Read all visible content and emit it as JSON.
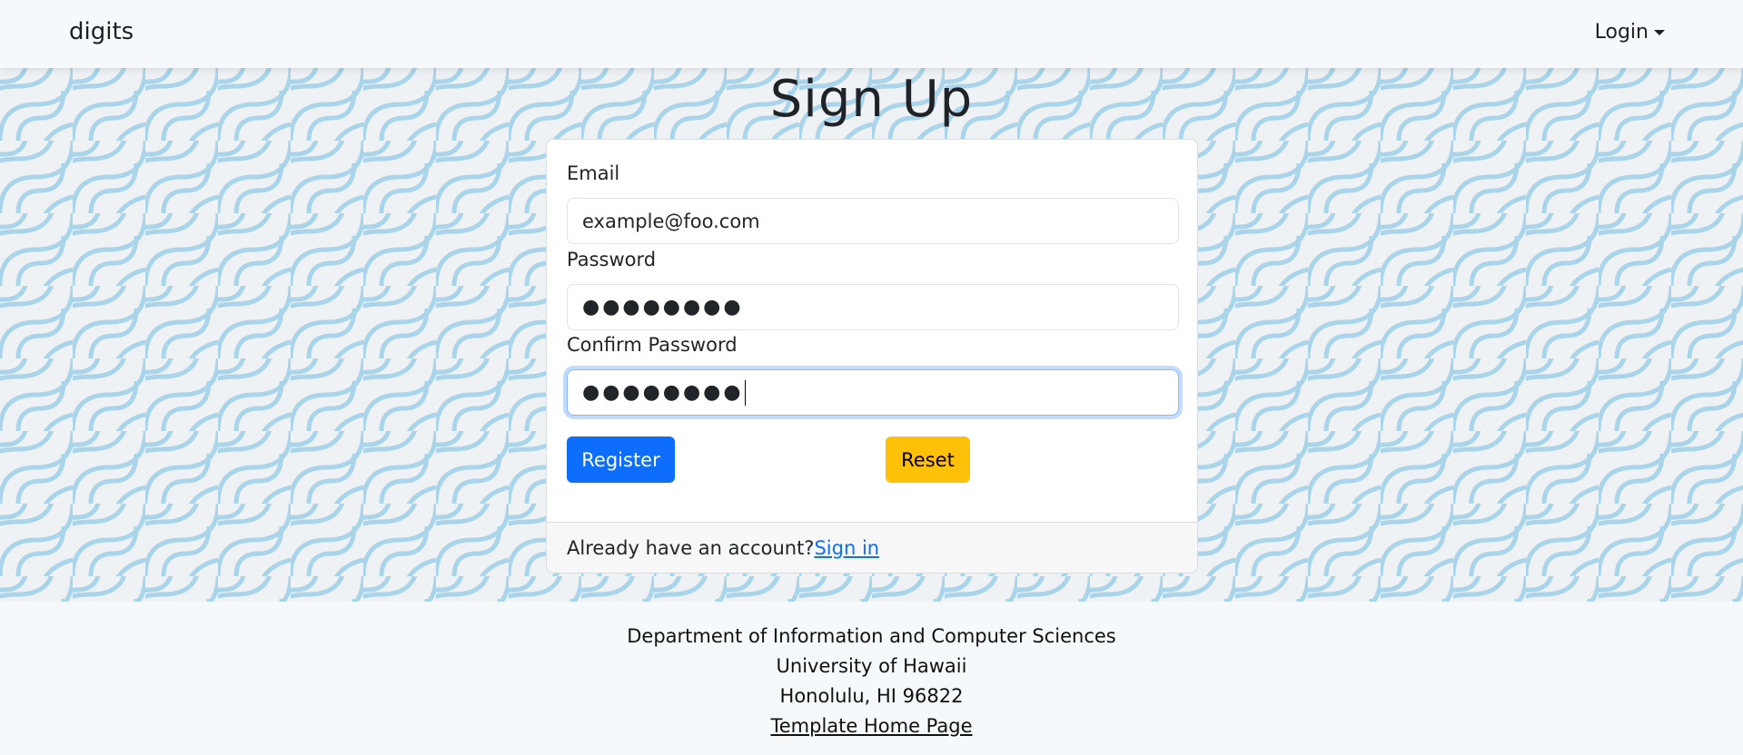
{
  "navbar": {
    "brand": "digits",
    "login_label": "Login"
  },
  "page_title": "Sign Up",
  "form": {
    "email_label": "Email",
    "email_value": "example@foo.com",
    "password_label": "Password",
    "password_value": "●●●●●●●●",
    "confirm_label": "Confirm Password",
    "confirm_value": "●●●●●●●●",
    "register_label": "Register",
    "reset_label": "Reset"
  },
  "card_footer": {
    "prompt": "Already have an account?",
    "link": "Sign in"
  },
  "footer": {
    "line1": "Department of Information and Computer Sciences",
    "line2": "University of Hawaii",
    "line3": "Honolulu, HI 96822",
    "link": "Template Home Page"
  },
  "colors": {
    "primary": "#0d6efd",
    "warning": "#ffc107",
    "pattern": "#a9d4ea"
  }
}
